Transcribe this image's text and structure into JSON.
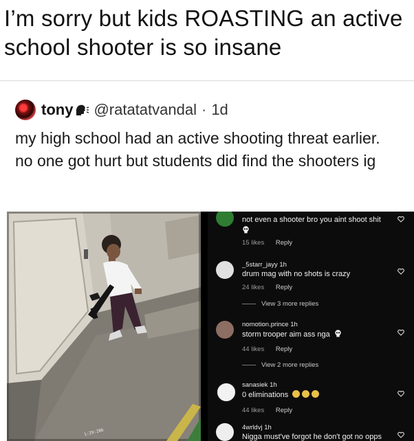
{
  "headline": "I’m sorry but kids ROASTING an active school shooter is so insane",
  "tweet": {
    "name": "tony",
    "handle": "@ratatatvandal",
    "separator": "·",
    "time": "1d",
    "text": "my high school had an active shooting threat earlier. no one got hurt but students did find the shooters ig"
  },
  "photo": {
    "timestamp": "1:29:286"
  },
  "comments": [
    {
      "username": "",
      "text": "not even a shooter bro you aint shoot shit",
      "likes": "15 likes",
      "reply": "Reply",
      "avatar_color": "#2e7d32"
    },
    {
      "username": "_5starr_jayy 1h",
      "text": "drum mag with no shots is crazy",
      "likes": "24 likes",
      "reply": "Reply",
      "avatar_color": "#e0e0e0"
    },
    {
      "username": "nomotion.prince 1h",
      "text": "storm trooper aim ass nga",
      "likes": "44 likes",
      "reply": "Reply",
      "avatar_color": "#8d6e63"
    },
    {
      "username": "sanasiek 1h",
      "text": "0 eliminations",
      "likes": "44 likes",
      "reply": "Reply",
      "avatar_color": "#f2f2f2"
    },
    {
      "username": "4wrldvj 1h",
      "text": "Nigga must've forgot he don't got no opps",
      "likes": "",
      "reply": "",
      "avatar_color": "#eeeeee"
    }
  ],
  "view_more": [
    "View 3 more replies",
    "View 2 more replies"
  ],
  "colors": {
    "accent_dark": "#0c0c0c",
    "text": "#111111"
  }
}
